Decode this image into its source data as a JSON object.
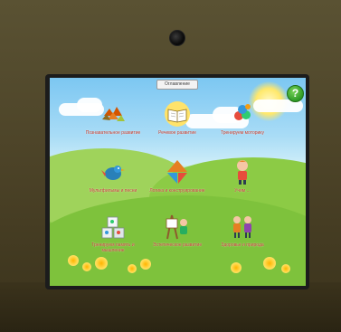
{
  "top_tab": "Оглавление",
  "help": {
    "glyph": "?"
  },
  "tiles": [
    {
      "label": "Познавательное развитие",
      "icon": "autumn-leaves-icon"
    },
    {
      "label": "Речевое развитие",
      "icon": "open-book-icon"
    },
    {
      "label": "Тренируем моторику",
      "icon": "balloons-icon"
    },
    {
      "label": "Мультфильмы и песни",
      "icon": "bird-icon"
    },
    {
      "label": "Логика и конструирование",
      "icon": "shapes-icon"
    },
    {
      "label": "Учим ...",
      "icon": "child-icon"
    },
    {
      "label": "Тренируем память и мышление",
      "icon": "cubes-icon"
    },
    {
      "label": "Эстетическое развитие",
      "icon": "easel-icon"
    },
    {
      "label": "Здоровье и природа",
      "icon": "kids-icon"
    }
  ],
  "colors": {
    "label": "#c0392b",
    "help_button": "#2e9a25"
  }
}
